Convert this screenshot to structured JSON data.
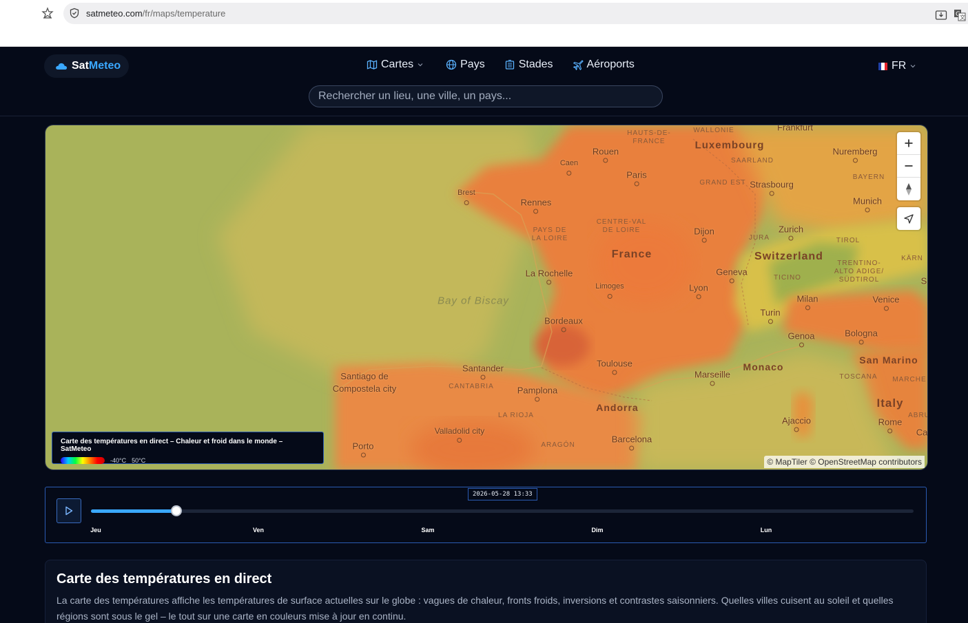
{
  "browser": {
    "url_domain": "satmeteo.com",
    "url_path": "/fr/maps/temperature"
  },
  "header": {
    "logo_part1": "Sat",
    "logo_part2": "Meteo",
    "nav": [
      {
        "label": "Cartes",
        "icon": "map-icon"
      },
      {
        "label": "Pays",
        "icon": "globe-icon"
      },
      {
        "label": "Stades",
        "icon": "stadium-icon"
      },
      {
        "label": "Aéroports",
        "icon": "plane-icon"
      }
    ],
    "language": "FR",
    "search_placeholder": "Rechercher un lieu, une ville, un pays..."
  },
  "map": {
    "labels": {
      "frankfurt": "Frankfurt",
      "luxembourg": "Luxembourg",
      "nuremberg": "Nuremberg",
      "rouen": "Rouen",
      "caen": "Caen",
      "paris": "Paris",
      "strasbourg": "Strasbourg",
      "munich": "Munich",
      "brest": "Brest",
      "rennes": "Rennes",
      "dijon": "Dijon",
      "zurich": "Zurich",
      "france": "France",
      "switzerland": "Switzerland",
      "la_rochelle": "La Rochelle",
      "geneva": "Geneva",
      "limoges": "Limoges",
      "lyon": "Lyon",
      "milan": "Milan",
      "venice": "Venice",
      "bay_of_biscay": "Bay of Biscay",
      "bordeaux": "Bordeaux",
      "turin": "Turin",
      "genoa": "Genoa",
      "bologna": "Bologna",
      "toulouse": "Toulouse",
      "san_marino": "San Marino",
      "santiago": "Santiago de\nCompostela city",
      "santander": "Santander",
      "marseille": "Marseille",
      "monaco": "Monaco",
      "pamplona": "Pamplona",
      "andorra": "Andorra",
      "italy": "Italy",
      "ajaccio": "Ajaccio",
      "rome": "Rome",
      "valladolid": "Valladolid city",
      "barcelona": "Barcelona",
      "porto": "Porto",
      "hauts_de_france": "HAUTS-DE-\nFRANCE",
      "wallonie": "WALLONIE",
      "saarland": "SAARLAND",
      "grand_est": "GRAND EST",
      "bayern": "BAYERN",
      "centre_val": "CENTRE-VAL\nDE LOIRE",
      "pays_de_la_loire": "PAYS DE\nLA LOIRE",
      "jura": "JURA",
      "tirol": "TIROL",
      "trentino": "TRENTINO-\nALTO ADIGE/\nSÜDTIROL",
      "ticino": "TICINO",
      "karn": "KÄRN",
      "toscana": "TOSCANA",
      "marche": "MARCHE",
      "abru": "ABRU",
      "cantabria": "CANTABRIA",
      "la_rioja": "LA RIOJA",
      "aragon": "ARAGÓN",
      "ca": "Ca",
      "s": "S"
    },
    "legend_title": "Carte des températures en direct – Chaleur et froid dans le monde – SatMeteo",
    "legend_min": "-40°C",
    "legend_max": "50°C",
    "attribution": "© MapTiler © OpenStreetMap contributors"
  },
  "timeline": {
    "current_time": "2026-05-28 13:33",
    "progress": 0.104,
    "days": [
      "Jeu",
      "Ven",
      "Sam",
      "Dim",
      "Lun"
    ]
  },
  "card": {
    "title": "Carte des températures en direct",
    "text": "La carte des températures affiche les températures de surface actuelles sur le globe : vagues de chaleur, fronts froids, inversions et contrastes saisonniers. Quelles villes cuisent au soleil et quelles régions sont sous le gel – le tout sur une carte en couleurs mise à jour en continu."
  },
  "colors": {
    "accent": "#3aa8ff",
    "background": "#050a18",
    "border_accent": "#2b5bb3"
  }
}
